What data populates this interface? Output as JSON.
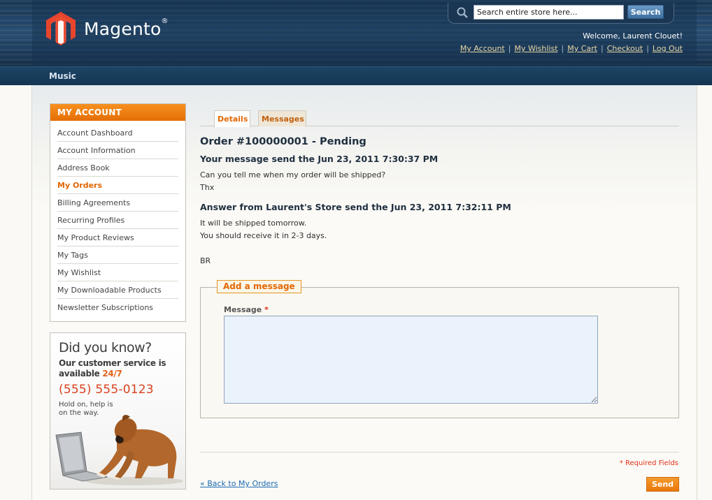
{
  "header": {
    "logo_text": "Magento",
    "logo_reg": "®",
    "search": {
      "placeholder": "Search entire store here...",
      "value": "Search entire store here...",
      "button": "Search"
    },
    "welcome": "Welcome, Laurent Clouet!",
    "links": [
      "My Account",
      "My Wishlist",
      "My Cart",
      "Checkout",
      "Log Out"
    ],
    "separator": "|"
  },
  "nav": {
    "items": [
      "Music"
    ]
  },
  "sidebar": {
    "title": "MY ACCOUNT",
    "items": [
      {
        "label": "Account Dashboard",
        "current": false
      },
      {
        "label": "Account Information",
        "current": false
      },
      {
        "label": "Address Book",
        "current": false
      },
      {
        "label": "My Orders",
        "current": true
      },
      {
        "label": "Billing Agreements",
        "current": false
      },
      {
        "label": "Recurring Profiles",
        "current": false
      },
      {
        "label": "My Product Reviews",
        "current": false
      },
      {
        "label": "My Tags",
        "current": false
      },
      {
        "label": "My Wishlist",
        "current": false
      },
      {
        "label": "My Downloadable Products",
        "current": false
      },
      {
        "label": "Newsletter Subscriptions",
        "current": false
      }
    ]
  },
  "promo": {
    "title": "Did you know?",
    "line1": "Our customer service is",
    "line2a": "available ",
    "line2b": "24/7",
    "phone": "(555) 555-0123",
    "hold": "Hold on, help is on the way."
  },
  "tabs": {
    "details": "Details",
    "messages": "Messages"
  },
  "order": {
    "title": "Order #100000001 - Pending",
    "message_header": "Your message send the Jun 23, 2011 7:30:37 PM",
    "message_lines": [
      "Can you tell me when my order will be shipped?",
      "Thx"
    ],
    "answer_header": "Answer from Laurent's Store send the Jun 23, 2011 7:32:11 PM",
    "answer_lines": [
      "It will be shipped tomorrow.",
      "You should receive it in 2-3 days.",
      "",
      "BR"
    ]
  },
  "form": {
    "legend": "Add a message",
    "message_label": "Message",
    "required_star": "*",
    "message_value": "",
    "required_note": "* Required Fields",
    "back_link": "« Back to My Orders",
    "send": "Send"
  },
  "colors": {
    "accent": "#e26703",
    "header_blue": "#1f3f60",
    "link_blue": "#1b6ab0",
    "required_red": "#e2301c"
  }
}
